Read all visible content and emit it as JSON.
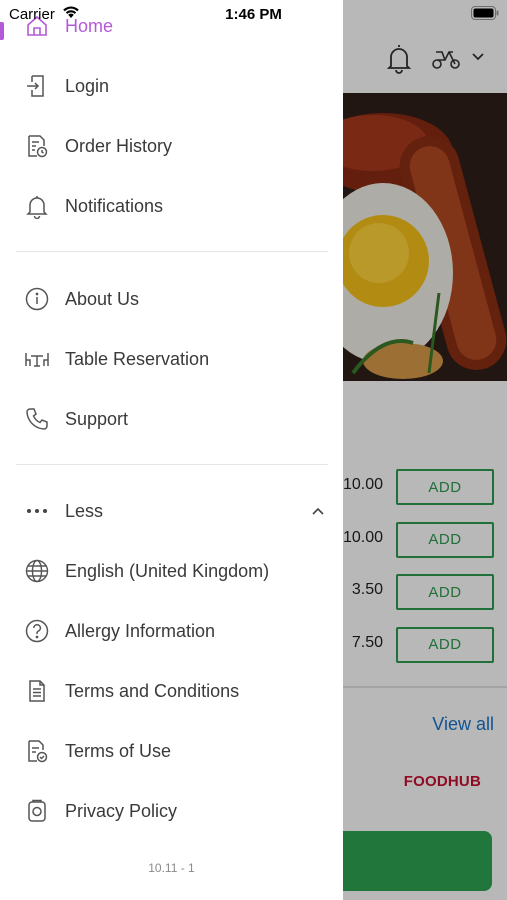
{
  "status_bar": {
    "carrier": "Carrier",
    "time": "1:46 PM"
  },
  "drawer": {
    "items": [
      {
        "label": "Home",
        "icon": "home-icon"
      },
      {
        "label": "Login",
        "icon": "login-icon"
      },
      {
        "label": "Order History",
        "icon": "order-history-icon"
      },
      {
        "label": "Notifications",
        "icon": "bell-icon"
      },
      {
        "label": "About Us",
        "icon": "info-icon"
      },
      {
        "label": "Table Reservation",
        "icon": "table-icon"
      },
      {
        "label": "Support",
        "icon": "phone-icon"
      },
      {
        "label": "Less",
        "icon": "more-dots-icon"
      },
      {
        "label": "English (United Kingdom)",
        "icon": "globe-icon"
      },
      {
        "label": "Allergy Information",
        "icon": "help-circle-icon"
      },
      {
        "label": "Terms and Conditions",
        "icon": "document-icon"
      },
      {
        "label": "Terms of Use",
        "icon": "document-check-icon"
      },
      {
        "label": "Privacy Policy",
        "icon": "privacy-icon"
      }
    ],
    "version": "10.11 - 1",
    "active_color": "#b45ad8"
  },
  "background": {
    "menu_items": [
      {
        "price": "10.00",
        "action": "ADD"
      },
      {
        "price": "10.00",
        "action": "ADD"
      },
      {
        "price": "3.50",
        "action": "ADD"
      },
      {
        "price": "7.50",
        "action": "ADD"
      }
    ],
    "view_all": "View all",
    "logo": "FOODHUB",
    "accent_color": "#2e9a4f",
    "link_color": "#1a74c9"
  }
}
